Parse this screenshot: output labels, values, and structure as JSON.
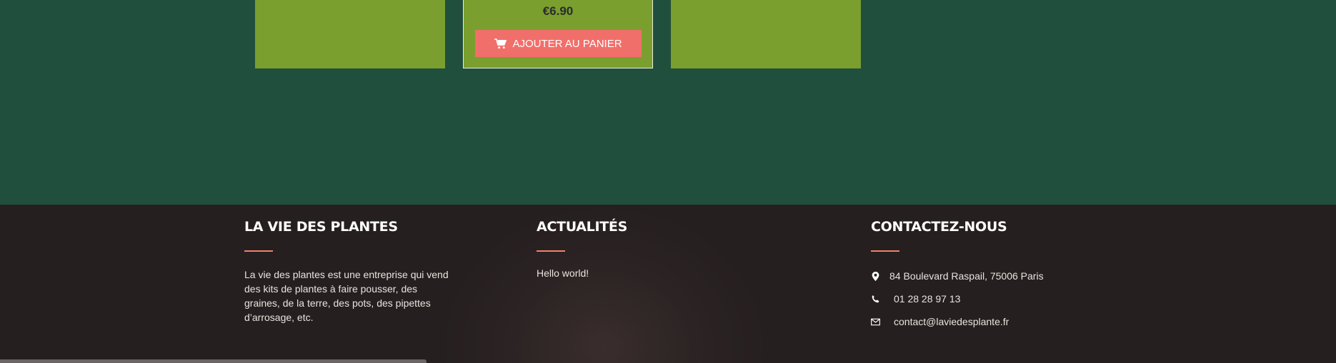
{
  "products": {
    "cards": [
      {
        "price": ""
      },
      {
        "price": "€6.90",
        "button_label": "AJOUTER AU PANIER",
        "button_icon": "cart-icon"
      },
      {
        "price": ""
      }
    ]
  },
  "footer": {
    "about": {
      "title": "LA VIE DES PLANTES",
      "text": "La vie des plantes est une entreprise qui vend des kits de plantes à faire pousser, des graines, de la terre, des pots, des pipettes d’arrosage, etc."
    },
    "news": {
      "title": "ACTUALITÉS",
      "links": [
        "Hello world!"
      ]
    },
    "contact": {
      "title": "CONTACTEZ-NOUS",
      "address": "84 Boulevard Raspail, 75006 Paris",
      "phone": "01 28 28 97 13",
      "email": "contact@laviedesplante.fr"
    }
  },
  "colors": {
    "page_bg": "#214f3d",
    "card_bg": "#7a9f2e",
    "button_bg": "#f16f6a",
    "footer_bg": "#2c2424",
    "accent_line": "#f2806b"
  }
}
